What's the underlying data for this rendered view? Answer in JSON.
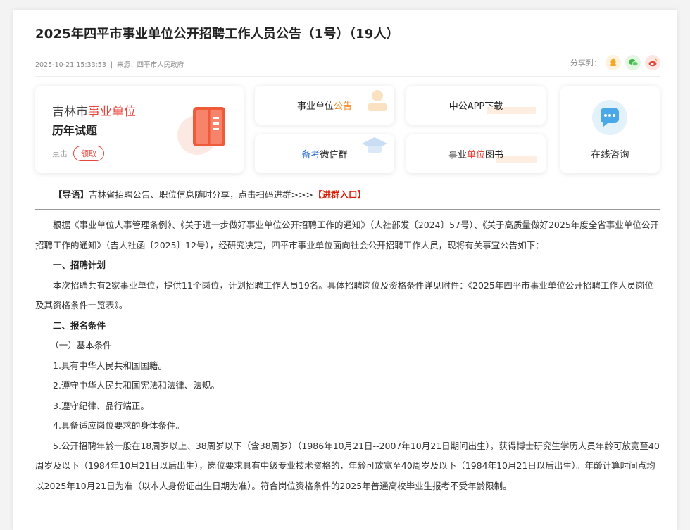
{
  "article": {
    "title": "2025年四平市事业单位公开招聘工作人员公告（1号）（19人）",
    "datetime": "2025-10-21 15:33:53",
    "source": "来源：四平市人民政府",
    "share_label": "分享到："
  },
  "promo": {
    "big_card": {
      "prefix": "吉林市",
      "highlight": "事业单位",
      "line2": "历年试题",
      "click": "点击",
      "button": "领取"
    },
    "card1": {
      "text": "事业单位",
      "highlight": "公告"
    },
    "card2": {
      "highlight": "备考",
      "text": "微信群"
    },
    "card3": {
      "text": "中公APP下载"
    },
    "card4": {
      "text1": "事业",
      "highlight": "单位",
      "text2": "图书"
    },
    "online": {
      "text": "在线咨询"
    }
  },
  "guide": {
    "label": "【导语】",
    "text": "吉林省招聘公告、职位信息随时分享，点击扫码进群>>>",
    "link": "【进群入口】"
  },
  "content": {
    "p1": "根据《事业单位人事管理条例》、《关于进一步做好事业单位公开招聘工作的通知》（人社部发〔2024〕57号）、《关于高质量做好2025年度全省事业单位公开招聘工作的通知》（吉人社函〔2025〕12号），经研究决定，四平市事业单位面向社会公开招聘工作人员，现将有关事宜公告如下：",
    "h1": "一、招聘计划",
    "p2": "本次招聘共有2家事业单位，提供11个岗位，计划招聘工作人员19名。具体招聘岗位及资格条件详见附件：《2025年四平市事业单位公开招聘工作人员岗位及其资格条件一览表》。",
    "h2": "二、报名条件",
    "sub1": "（一）基本条件",
    "i1": "1.具有中华人民共和国国籍。",
    "i2": "2.遵守中华人民共和国宪法和法律、法规。",
    "i3": "3.遵守纪律、品行端正。",
    "i4": "4.具备适应岗位要求的身体条件。",
    "i5": "5.公开招聘年龄一般在18周岁以上、38周岁以下（含38周岁）（1986年10月21日--2007年10月21日期间出生），获得博士研究生学历人员年龄可放宽至40周岁及以下（1984年10月21日以后出生），岗位要求具有中级专业技术资格的，年龄可放宽至40周岁及以下（1984年10月21日以后出生）。年龄计算时间点均以2025年10月21日为准（以本人身份证出生日期为准）。符合岗位资格条件的2025年普通高校毕业生报考不受年龄限制。"
  },
  "colors": {
    "accent_red": "#e8453c",
    "accent_orange": "#f08a24",
    "accent_blue": "#2f6fd0",
    "link_red": "#d81e06"
  }
}
